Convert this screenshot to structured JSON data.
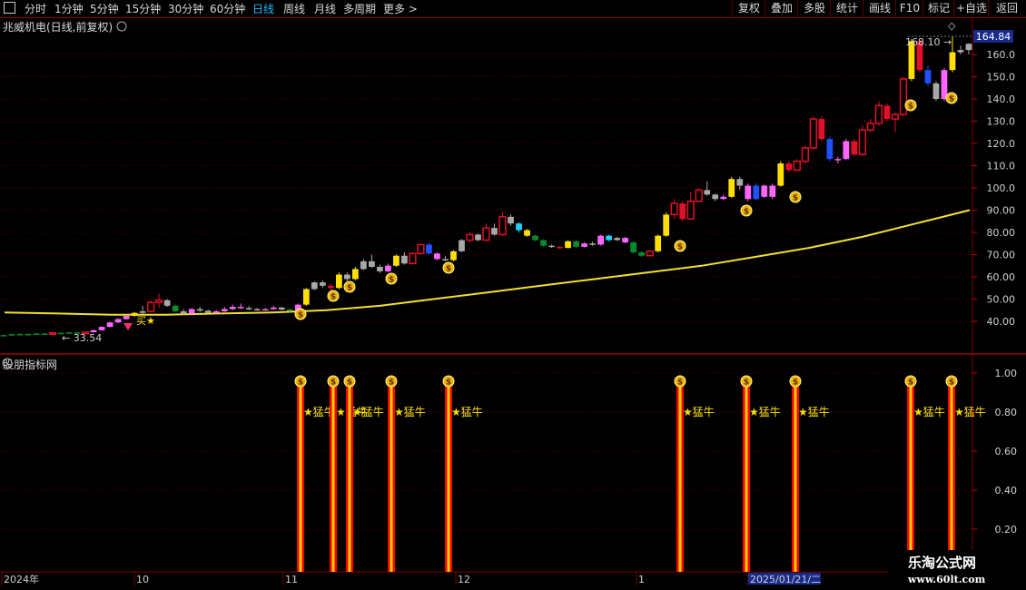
{
  "toolbar": {
    "left_items": [
      "分时",
      "1分钟",
      "5分钟",
      "15分钟",
      "30分钟",
      "60分钟",
      "日线",
      "周线",
      "月线",
      "多周期",
      "更多 >"
    ],
    "active_index": 6,
    "right_items": [
      "复权",
      "叠加",
      "多股",
      "统计",
      "画线",
      "F10",
      "标记",
      "+自选",
      "返回"
    ]
  },
  "stock_title": "兆威机电(日线,前复权)",
  "indicator_title": "股朋指标网",
  "price_panel": {
    "y_ticks": [
      "160.0",
      "150.0",
      "140.0",
      "130.0",
      "120.0",
      "110.0",
      "100.0",
      "90.00",
      "80.00",
      "70.00",
      "60.00",
      "50.00",
      "40.00"
    ],
    "current_price": "164.84",
    "high_label": "168.10",
    "low_label": "33.54",
    "buy_mark": "买"
  },
  "indicator_panel": {
    "y_ticks": [
      "1.00",
      "0.80",
      "0.60",
      "0.40",
      "0.20"
    ],
    "signal_label": "★猛牛"
  },
  "x_axis": {
    "labels": [
      "2024年",
      "10",
      "11",
      "12",
      "1",
      "2025/01/21/二"
    ]
  },
  "watermark": {
    "line1": "乐淘公式网",
    "line2": "www.60lt.com"
  },
  "colors": {
    "up": "#e0102a",
    "down_green": "#0a8a2a",
    "pink": "#ff66ff",
    "gray": "#a8a8a8",
    "yellow": "#ffe000",
    "ma": "#f2e030",
    "signal_red": "#ff0000",
    "axis": "#7a0000"
  },
  "chart_data": {
    "type": "candlestick",
    "y_range": [
      30,
      172
    ],
    "ma_line": [
      44,
      43.5,
      43,
      43,
      43.5,
      44,
      45,
      47,
      50,
      53,
      56,
      59,
      62,
      65,
      69,
      73,
      78,
      84,
      90
    ],
    "candles": [
      [
        33.5,
        33.8,
        33.2,
        34,
        "green"
      ],
      [
        34,
        34.2,
        33.6,
        34.5,
        "green"
      ],
      [
        34.2,
        34.3,
        33.8,
        34.6,
        "green"
      ],
      [
        34.3,
        34.1,
        33.7,
        34.6,
        "green"
      ],
      [
        34.1,
        34.5,
        33.9,
        34.8,
        "green"
      ],
      [
        34.5,
        34.3,
        34,
        34.8,
        "green"
      ],
      [
        34.3,
        34.8,
        34.1,
        35,
        "red"
      ],
      [
        34.8,
        34.6,
        34.2,
        35.1,
        "green"
      ],
      [
        34.6,
        35,
        34.4,
        35.2,
        "green"
      ],
      [
        35,
        34.7,
        34.4,
        35.2,
        "green"
      ],
      [
        34.7,
        35.1,
        34.5,
        35.3,
        "red"
      ],
      [
        35.1,
        36,
        34.9,
        36.3,
        "pink"
      ],
      [
        36,
        37.5,
        35.8,
        37.8,
        "pink"
      ],
      [
        37.5,
        39.5,
        37.2,
        39.8,
        "pink"
      ],
      [
        39.5,
        41,
        39.2,
        41.4,
        "pink"
      ],
      [
        41,
        42.5,
        40.6,
        42.9,
        "pink"
      ],
      [
        42.5,
        43.8,
        42,
        44.2,
        "yellow"
      ],
      [
        43.8,
        44.5,
        43.3,
        47,
        "gray"
      ],
      [
        44.5,
        48.5,
        44,
        49.5,
        "red"
      ],
      [
        48.5,
        49.5,
        46,
        52.5,
        "red"
      ],
      [
        49.5,
        47,
        46.5,
        50,
        "gray"
      ],
      [
        47,
        44.5,
        44,
        47.5,
        "green"
      ],
      [
        44.5,
        43.5,
        43,
        45.5,
        "gray"
      ],
      [
        43.5,
        45.5,
        43.2,
        46,
        "pink"
      ],
      [
        45.5,
        44.8,
        44.2,
        46.5,
        "gray"
      ],
      [
        44.8,
        43.8,
        43.5,
        45.2,
        "gray"
      ],
      [
        43.8,
        44.5,
        43.5,
        45,
        "pink"
      ],
      [
        44.5,
        45.5,
        44.2,
        46.5,
        "pink"
      ],
      [
        45.5,
        46.5,
        45,
        47.5,
        "pink"
      ],
      [
        46.5,
        46,
        45.5,
        48,
        "pink"
      ],
      [
        46,
        45.5,
        45,
        46.8,
        "gray"
      ],
      [
        45.5,
        45.2,
        44.8,
        46,
        "gray"
      ],
      [
        45.2,
        45.5,
        44.9,
        46,
        "pink"
      ],
      [
        45.5,
        46.2,
        45.2,
        47,
        "pink"
      ],
      [
        46.2,
        45.3,
        44.9,
        46.5,
        "gray"
      ],
      [
        45.3,
        44.7,
        44.4,
        45.8,
        "green"
      ],
      [
        44.7,
        47.5,
        44.5,
        48,
        "pink"
      ],
      [
        47.5,
        54.5,
        47,
        55,
        "yellow"
      ],
      [
        54.5,
        57.5,
        54,
        58,
        "gray"
      ],
      [
        57.5,
        56,
        55,
        58.5,
        "gray"
      ],
      [
        56,
        55,
        54,
        57,
        "red"
      ],
      [
        55,
        61,
        54.5,
        62,
        "yellow"
      ],
      [
        61,
        59,
        58,
        62,
        "gray"
      ],
      [
        59,
        63.5,
        58.5,
        64.5,
        "yellow"
      ],
      [
        63.5,
        67,
        63,
        68,
        "gray"
      ],
      [
        67,
        64.5,
        64,
        70,
        "gray"
      ],
      [
        64.5,
        62.5,
        61.8,
        65.5,
        "gray"
      ],
      [
        62.5,
        65,
        62,
        66,
        "pink"
      ],
      [
        65,
        69.5,
        64.5,
        70,
        "yellow"
      ],
      [
        69.5,
        66,
        65.5,
        71,
        "gray"
      ],
      [
        66,
        70.5,
        65.5,
        71,
        "red"
      ],
      [
        70.5,
        74.5,
        70,
        75,
        "red"
      ],
      [
        74.5,
        70.5,
        70,
        75.5,
        "blue"
      ],
      [
        70.5,
        68,
        67.5,
        71,
        "pink"
      ],
      [
        68,
        67.5,
        67,
        69.5,
        "gray"
      ],
      [
        67.5,
        71.5,
        67,
        72,
        "yellow"
      ],
      [
        71.5,
        76.5,
        71,
        77,
        "gray"
      ],
      [
        76.5,
        79,
        75.5,
        80,
        "red"
      ],
      [
        79,
        76.5,
        76,
        79.5,
        "gray"
      ],
      [
        76.5,
        82,
        76,
        84,
        "red"
      ],
      [
        82,
        79,
        78.5,
        84,
        "gray"
      ],
      [
        79,
        87,
        78.5,
        89,
        "red"
      ],
      [
        87,
        84,
        83,
        88,
        "gray"
      ],
      [
        84,
        81,
        80,
        84.5,
        "cyan"
      ],
      [
        81,
        78.5,
        78,
        81.5,
        "yellow"
      ],
      [
        78.5,
        76.5,
        76,
        79,
        "green"
      ],
      [
        76.5,
        74,
        73.5,
        77,
        "green"
      ],
      [
        74,
        73.5,
        73,
        74.5,
        "gray"
      ],
      [
        73.5,
        73,
        72.5,
        74,
        "red"
      ],
      [
        73,
        76,
        72.8,
        76.5,
        "yellow"
      ],
      [
        76,
        73.5,
        73,
        76.5,
        "green"
      ],
      [
        73.5,
        75,
        73.2,
        75.5,
        "pink"
      ],
      [
        75,
        74.5,
        74,
        75.8,
        "gray"
      ],
      [
        74.5,
        78.5,
        74,
        79,
        "pink"
      ],
      [
        78.5,
        76.5,
        76,
        79,
        "cyan"
      ],
      [
        76.5,
        77.5,
        76.2,
        78,
        "gray"
      ],
      [
        77.5,
        75.5,
        75,
        78,
        "pink"
      ],
      [
        75.5,
        71,
        70.5,
        76,
        "green"
      ],
      [
        71,
        69.5,
        69,
        71.5,
        "green"
      ],
      [
        69.5,
        71.5,
        69.2,
        72,
        "red"
      ],
      [
        71.5,
        78.5,
        71,
        79,
        "yellow"
      ],
      [
        78.5,
        88,
        78,
        89,
        "yellow"
      ],
      [
        88,
        93,
        86,
        95,
        "red"
      ],
      [
        93,
        86,
        85,
        94,
        "red"
      ],
      [
        86,
        94,
        85.5,
        98,
        "red"
      ],
      [
        94,
        99,
        93.5,
        100,
        "red"
      ],
      [
        99,
        97,
        96.5,
        103,
        "gray"
      ],
      [
        97,
        95,
        94,
        97.5,
        "gray"
      ],
      [
        95,
        96,
        94.5,
        97,
        "pink"
      ],
      [
        96,
        104,
        95.5,
        105,
        "yellow"
      ],
      [
        104,
        101,
        99,
        105,
        "gray"
      ],
      [
        101,
        95,
        94,
        102,
        "pink"
      ],
      [
        95,
        101,
        94.5,
        102,
        "blue"
      ],
      [
        101,
        96,
        95.5,
        101.5,
        "pink"
      ],
      [
        96,
        101,
        95,
        102,
        "pink"
      ],
      [
        101,
        111,
        100.5,
        112,
        "yellow"
      ],
      [
        111,
        108,
        107,
        112,
        "red"
      ],
      [
        108,
        112,
        107.5,
        113,
        "red"
      ],
      [
        112,
        118,
        111,
        119,
        "red"
      ],
      [
        118,
        131,
        117,
        132,
        "red"
      ],
      [
        131,
        122,
        121,
        132,
        "red"
      ],
      [
        122,
        113,
        112,
        123,
        "blue"
      ],
      [
        113,
        113,
        111,
        114,
        "pink"
      ],
      [
        113,
        121,
        112.5,
        122,
        "pink"
      ],
      [
        121,
        115,
        114,
        122,
        "red"
      ],
      [
        115,
        126,
        114.5,
        128,
        "red"
      ],
      [
        126,
        129,
        125,
        131,
        "red"
      ],
      [
        129,
        137,
        128,
        139,
        "red"
      ],
      [
        137,
        131,
        130,
        138,
        "red"
      ],
      [
        131,
        133,
        125,
        134,
        "red"
      ],
      [
        133,
        149,
        132,
        150,
        "red"
      ],
      [
        149,
        166,
        148,
        167,
        "yellow"
      ],
      [
        166,
        153,
        152,
        167,
        "red"
      ],
      [
        153,
        147,
        146,
        155,
        "blue"
      ],
      [
        147,
        140,
        139,
        148,
        "gray"
      ],
      [
        140,
        153,
        139,
        154,
        "pink"
      ],
      [
        153,
        161,
        152,
        168,
        "yellow"
      ],
      [
        161,
        162,
        160,
        164,
        "gray"
      ],
      [
        162,
        164.8,
        160,
        165,
        "gray"
      ]
    ],
    "indicator_signals_x": [
      331,
      367,
      385,
      431,
      494,
      749,
      822,
      876,
      1003,
      1048
    ],
    "indicator_signal_value": 1.0,
    "indicator_y_range": [
      0.05,
      1.05
    ]
  }
}
